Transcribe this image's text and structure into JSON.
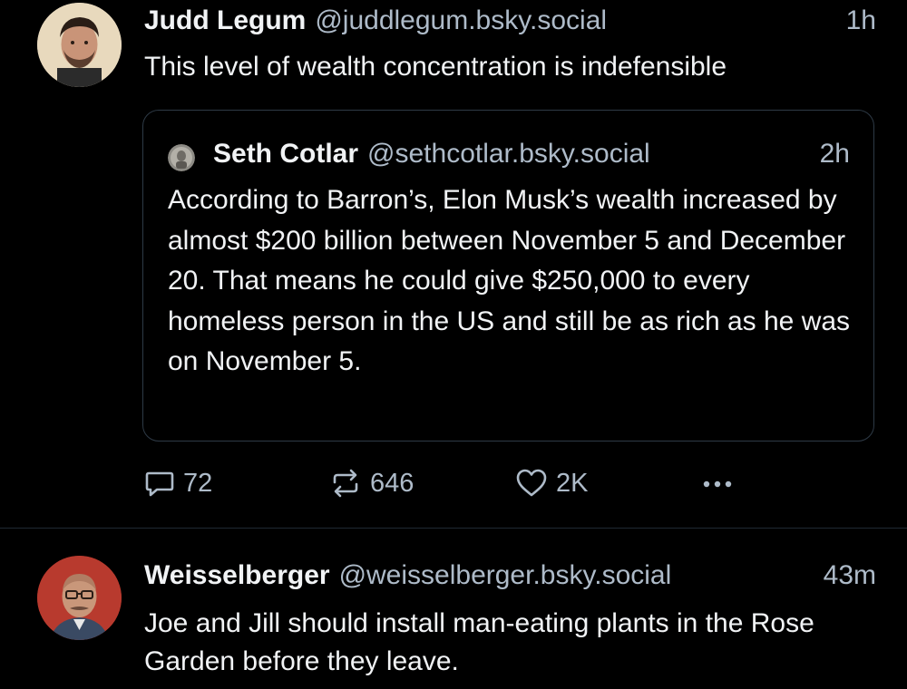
{
  "posts": [
    {
      "display_name": "Judd Legum",
      "handle": "@juddlegum.bsky.social",
      "time": "1h",
      "text": "This level of wealth concentration is indefensible",
      "quote": {
        "display_name": "Seth Cotlar",
        "handle": "@sethcotlar.bsky.social",
        "time": "2h",
        "text": "According to Barron’s, Elon Musk’s wealth increased by almost $200 billion between November 5 and December 20. That means he could give $250,000 to every homeless person in the US and still be as rich as he was on November 5."
      },
      "actions": {
        "reply_icon": "speech-bubble-icon",
        "reply_count": "72",
        "repost_icon": "repost-arrows-icon",
        "repost_count": "646",
        "like_icon": "heart-outline-icon",
        "like_count": "2K",
        "more_icon": "ellipsis-icon"
      }
    },
    {
      "display_name": "Weisselberger",
      "handle": "@weisselberger.bsky.social",
      "time": "43m",
      "text": "Joe and Jill should install man-eating plants in the Rose Garden before they leave."
    }
  ],
  "colors": {
    "background": "#000000",
    "primary_text": "#f1f3f5",
    "secondary_text": "#aebbc9",
    "border": "#2e3a46"
  }
}
